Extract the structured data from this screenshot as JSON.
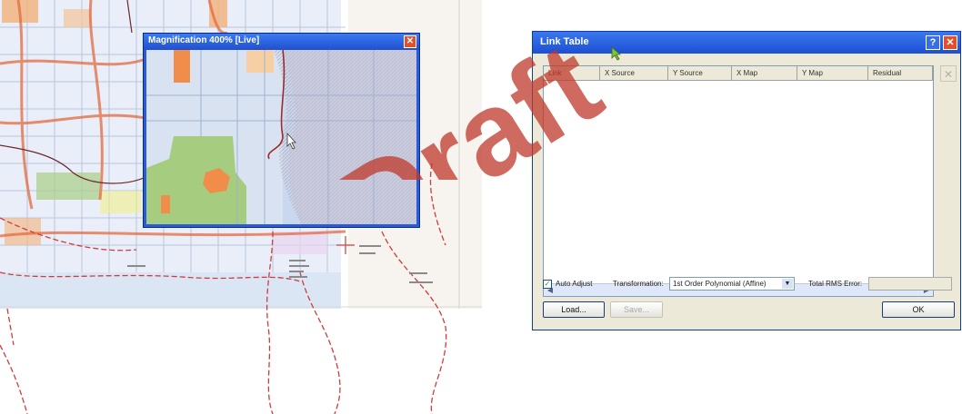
{
  "magnifier": {
    "title": "Magnification 400% [Live]",
    "close_glyph": "✕"
  },
  "dialog": {
    "title": "Link Table",
    "help_glyph": "?",
    "close_glyph": "✕",
    "delete_glyph": "✕",
    "columns": [
      "Link",
      "X Source",
      "Y Source",
      "X Map",
      "Y Map",
      "Residual"
    ],
    "auto_adjust_checked": true,
    "auto_adjust_label": "Auto Adjust",
    "transformation_label": "Transformation:",
    "transformation_value": "1st Order Polynomial (Affine)",
    "rms_label": "Total RMS Error:",
    "rms_value": "",
    "buttons": {
      "load": "Load...",
      "save": "Save...",
      "ok": "OK"
    },
    "scroll_left": "◀",
    "scroll_right": "▶"
  },
  "watermark": "Draft",
  "colors": {
    "title_blue": "#2a5bd8",
    "road_red": "#d64a3a",
    "parcel_orange": "#f0a060",
    "parcel_green": "#a9cf86",
    "water_blue": "#cddcf2",
    "watermark_red": "#c0392b"
  }
}
